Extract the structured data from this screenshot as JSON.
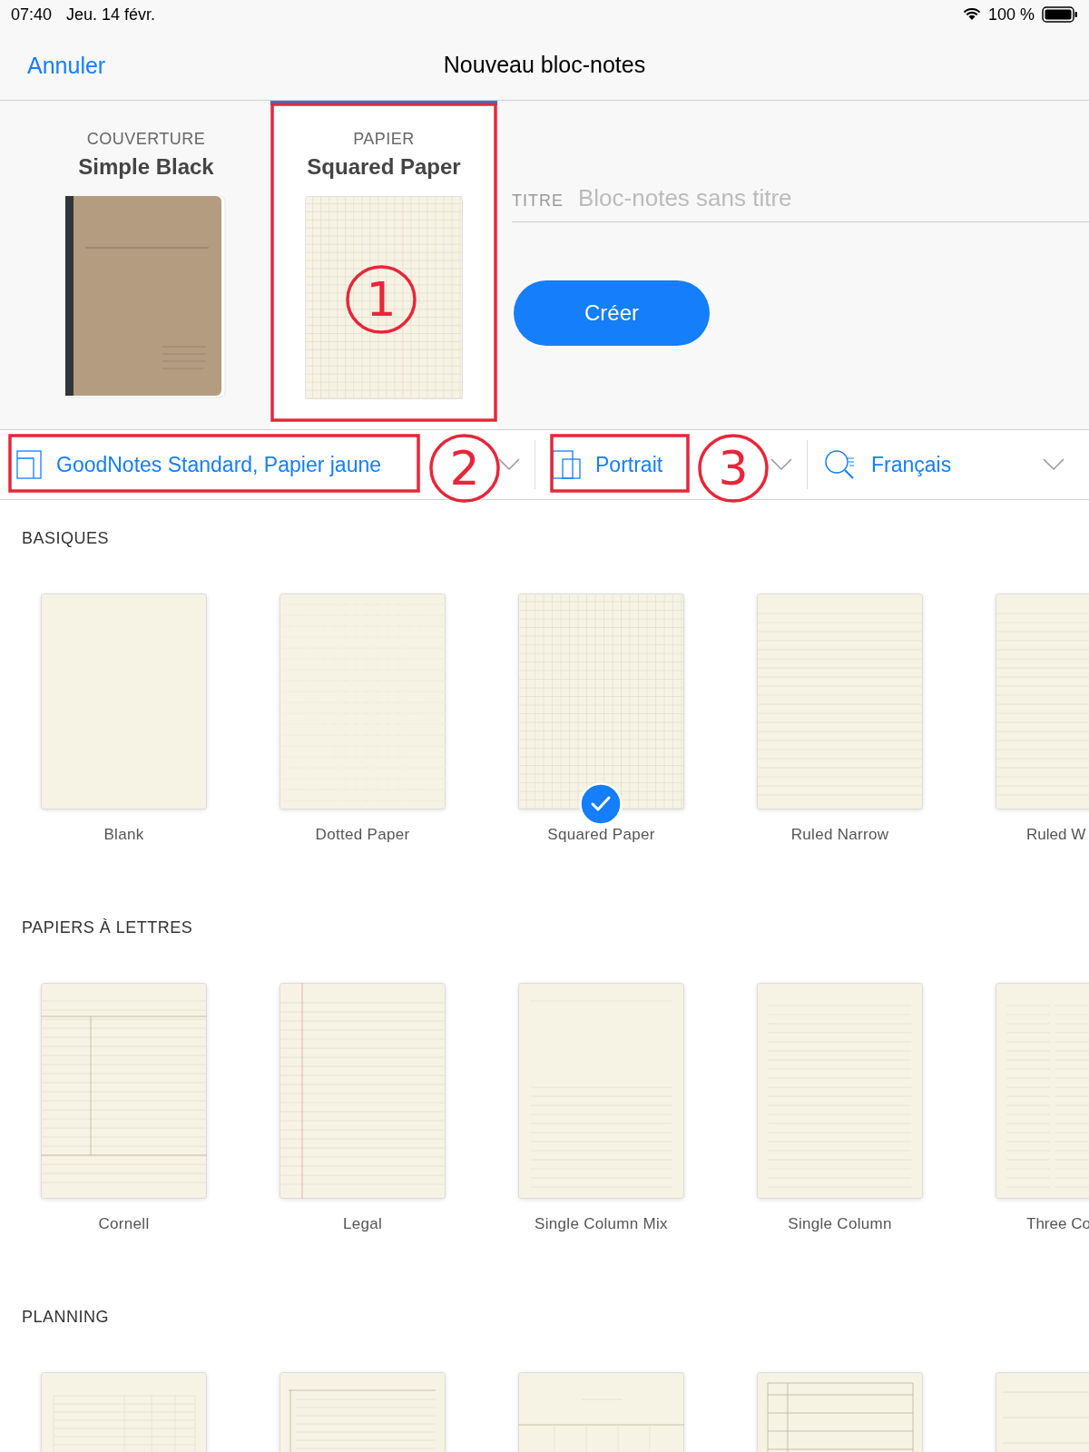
{
  "status_bar": {
    "time": "07:40",
    "date": "Jeu. 14 févr.",
    "battery": "100 %"
  },
  "nav": {
    "cancel": "Annuler",
    "title": "Nouveau bloc-notes"
  },
  "cover": {
    "caption": "COUVERTURE",
    "name": "Simple Black"
  },
  "paper": {
    "caption": "PAPIER",
    "name": "Squared Paper",
    "selected": true
  },
  "title_field": {
    "label": "TITRE",
    "placeholder": "Bloc-notes sans titre"
  },
  "create_button": "Créer",
  "toolbar": [
    {
      "kind": "template",
      "label": "GoodNotes Standard, Papier jaune"
    },
    {
      "kind": "orientation",
      "label": "Portrait"
    },
    {
      "kind": "language",
      "label": "Français"
    }
  ],
  "sections": [
    {
      "title": "BASIQUES",
      "templates": [
        {
          "name": "Blank",
          "kind": "blank",
          "selected": false
        },
        {
          "name": "Dotted Paper",
          "kind": "dotted",
          "selected": false
        },
        {
          "name": "Squared Paper",
          "kind": "squared",
          "selected": true
        },
        {
          "name": "Ruled Narrow",
          "kind": "ruled_narrow",
          "selected": false
        },
        {
          "name": "Ruled W",
          "kind": "ruled_wide",
          "selected": false
        }
      ]
    },
    {
      "title": "PAPIERS À LETTRES",
      "templates": [
        {
          "name": "Cornell",
          "kind": "cornell",
          "selected": false
        },
        {
          "name": "Legal",
          "kind": "legal",
          "selected": false
        },
        {
          "name": "Single Column Mix",
          "kind": "single_column_mix",
          "selected": false
        },
        {
          "name": "Single Column",
          "kind": "single_column",
          "selected": false
        },
        {
          "name": "Three Co",
          "kind": "three_column",
          "selected": false
        }
      ]
    },
    {
      "title": "PLANNING",
      "templates": [
        {
          "kind": "table"
        },
        {
          "kind": "numbered"
        },
        {
          "kind": "calendar"
        },
        {
          "kind": "checklist"
        },
        {
          "kind": "weekly"
        }
      ]
    }
  ],
  "annotations": [
    {
      "label": "1"
    },
    {
      "label": "2"
    },
    {
      "label": "3"
    }
  ]
}
